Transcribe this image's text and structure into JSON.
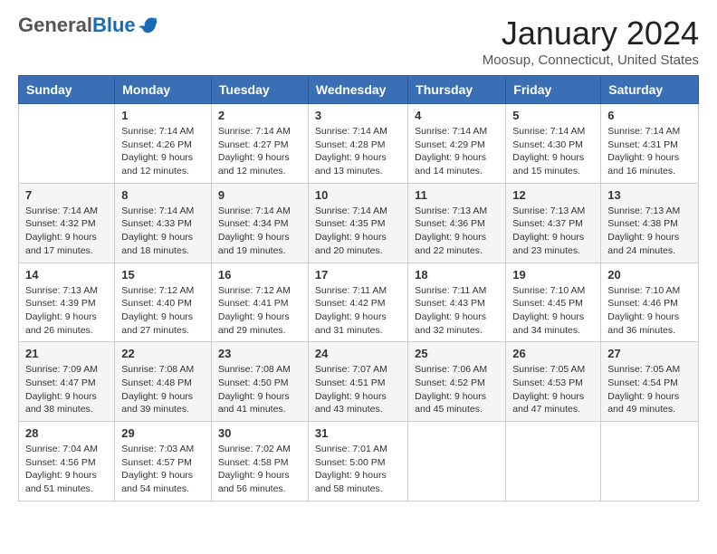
{
  "header": {
    "logo_general": "General",
    "logo_blue": "Blue",
    "month_title": "January 2024",
    "location": "Moosup, Connecticut, United States"
  },
  "weekdays": [
    "Sunday",
    "Monday",
    "Tuesday",
    "Wednesday",
    "Thursday",
    "Friday",
    "Saturday"
  ],
  "weeks": [
    [
      {
        "day": "",
        "sunrise": "",
        "sunset": "",
        "daylight": ""
      },
      {
        "day": "1",
        "sunrise": "Sunrise: 7:14 AM",
        "sunset": "Sunset: 4:26 PM",
        "daylight": "Daylight: 9 hours and 12 minutes."
      },
      {
        "day": "2",
        "sunrise": "Sunrise: 7:14 AM",
        "sunset": "Sunset: 4:27 PM",
        "daylight": "Daylight: 9 hours and 12 minutes."
      },
      {
        "day": "3",
        "sunrise": "Sunrise: 7:14 AM",
        "sunset": "Sunset: 4:28 PM",
        "daylight": "Daylight: 9 hours and 13 minutes."
      },
      {
        "day": "4",
        "sunrise": "Sunrise: 7:14 AM",
        "sunset": "Sunset: 4:29 PM",
        "daylight": "Daylight: 9 hours and 14 minutes."
      },
      {
        "day": "5",
        "sunrise": "Sunrise: 7:14 AM",
        "sunset": "Sunset: 4:30 PM",
        "daylight": "Daylight: 9 hours and 15 minutes."
      },
      {
        "day": "6",
        "sunrise": "Sunrise: 7:14 AM",
        "sunset": "Sunset: 4:31 PM",
        "daylight": "Daylight: 9 hours and 16 minutes."
      }
    ],
    [
      {
        "day": "7",
        "sunrise": "Sunrise: 7:14 AM",
        "sunset": "Sunset: 4:32 PM",
        "daylight": "Daylight: 9 hours and 17 minutes."
      },
      {
        "day": "8",
        "sunrise": "Sunrise: 7:14 AM",
        "sunset": "Sunset: 4:33 PM",
        "daylight": "Daylight: 9 hours and 18 minutes."
      },
      {
        "day": "9",
        "sunrise": "Sunrise: 7:14 AM",
        "sunset": "Sunset: 4:34 PM",
        "daylight": "Daylight: 9 hours and 19 minutes."
      },
      {
        "day": "10",
        "sunrise": "Sunrise: 7:14 AM",
        "sunset": "Sunset: 4:35 PM",
        "daylight": "Daylight: 9 hours and 20 minutes."
      },
      {
        "day": "11",
        "sunrise": "Sunrise: 7:13 AM",
        "sunset": "Sunset: 4:36 PM",
        "daylight": "Daylight: 9 hours and 22 minutes."
      },
      {
        "day": "12",
        "sunrise": "Sunrise: 7:13 AM",
        "sunset": "Sunset: 4:37 PM",
        "daylight": "Daylight: 9 hours and 23 minutes."
      },
      {
        "day": "13",
        "sunrise": "Sunrise: 7:13 AM",
        "sunset": "Sunset: 4:38 PM",
        "daylight": "Daylight: 9 hours and 24 minutes."
      }
    ],
    [
      {
        "day": "14",
        "sunrise": "Sunrise: 7:13 AM",
        "sunset": "Sunset: 4:39 PM",
        "daylight": "Daylight: 9 hours and 26 minutes."
      },
      {
        "day": "15",
        "sunrise": "Sunrise: 7:12 AM",
        "sunset": "Sunset: 4:40 PM",
        "daylight": "Daylight: 9 hours and 27 minutes."
      },
      {
        "day": "16",
        "sunrise": "Sunrise: 7:12 AM",
        "sunset": "Sunset: 4:41 PM",
        "daylight": "Daylight: 9 hours and 29 minutes."
      },
      {
        "day": "17",
        "sunrise": "Sunrise: 7:11 AM",
        "sunset": "Sunset: 4:42 PM",
        "daylight": "Daylight: 9 hours and 31 minutes."
      },
      {
        "day": "18",
        "sunrise": "Sunrise: 7:11 AM",
        "sunset": "Sunset: 4:43 PM",
        "daylight": "Daylight: 9 hours and 32 minutes."
      },
      {
        "day": "19",
        "sunrise": "Sunrise: 7:10 AM",
        "sunset": "Sunset: 4:45 PM",
        "daylight": "Daylight: 9 hours and 34 minutes."
      },
      {
        "day": "20",
        "sunrise": "Sunrise: 7:10 AM",
        "sunset": "Sunset: 4:46 PM",
        "daylight": "Daylight: 9 hours and 36 minutes."
      }
    ],
    [
      {
        "day": "21",
        "sunrise": "Sunrise: 7:09 AM",
        "sunset": "Sunset: 4:47 PM",
        "daylight": "Daylight: 9 hours and 38 minutes."
      },
      {
        "day": "22",
        "sunrise": "Sunrise: 7:08 AM",
        "sunset": "Sunset: 4:48 PM",
        "daylight": "Daylight: 9 hours and 39 minutes."
      },
      {
        "day": "23",
        "sunrise": "Sunrise: 7:08 AM",
        "sunset": "Sunset: 4:50 PM",
        "daylight": "Daylight: 9 hours and 41 minutes."
      },
      {
        "day": "24",
        "sunrise": "Sunrise: 7:07 AM",
        "sunset": "Sunset: 4:51 PM",
        "daylight": "Daylight: 9 hours and 43 minutes."
      },
      {
        "day": "25",
        "sunrise": "Sunrise: 7:06 AM",
        "sunset": "Sunset: 4:52 PM",
        "daylight": "Daylight: 9 hours and 45 minutes."
      },
      {
        "day": "26",
        "sunrise": "Sunrise: 7:05 AM",
        "sunset": "Sunset: 4:53 PM",
        "daylight": "Daylight: 9 hours and 47 minutes."
      },
      {
        "day": "27",
        "sunrise": "Sunrise: 7:05 AM",
        "sunset": "Sunset: 4:54 PM",
        "daylight": "Daylight: 9 hours and 49 minutes."
      }
    ],
    [
      {
        "day": "28",
        "sunrise": "Sunrise: 7:04 AM",
        "sunset": "Sunset: 4:56 PM",
        "daylight": "Daylight: 9 hours and 51 minutes."
      },
      {
        "day": "29",
        "sunrise": "Sunrise: 7:03 AM",
        "sunset": "Sunset: 4:57 PM",
        "daylight": "Daylight: 9 hours and 54 minutes."
      },
      {
        "day": "30",
        "sunrise": "Sunrise: 7:02 AM",
        "sunset": "Sunset: 4:58 PM",
        "daylight": "Daylight: 9 hours and 56 minutes."
      },
      {
        "day": "31",
        "sunrise": "Sunrise: 7:01 AM",
        "sunset": "Sunset: 5:00 PM",
        "daylight": "Daylight: 9 hours and 58 minutes."
      },
      {
        "day": "",
        "sunrise": "",
        "sunset": "",
        "daylight": ""
      },
      {
        "day": "",
        "sunrise": "",
        "sunset": "",
        "daylight": ""
      },
      {
        "day": "",
        "sunrise": "",
        "sunset": "",
        "daylight": ""
      }
    ]
  ]
}
